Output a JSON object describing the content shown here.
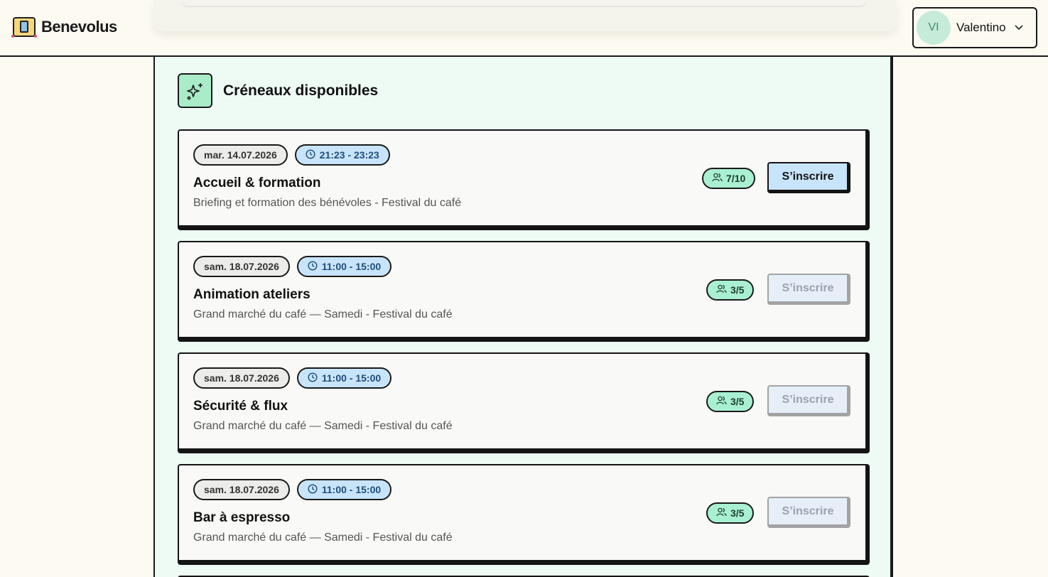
{
  "app": {
    "name": "Benevolus"
  },
  "user": {
    "initials": "VI",
    "name": "Valentino"
  },
  "section": {
    "title": "Créneaux disponibles"
  },
  "slots": [
    {
      "date": "mar. 14.07.2026",
      "time": "21:23 - 23:23",
      "title": "Accueil & formation",
      "description": "Briefing et formation des bénévoles - Festival du café",
      "count": "7/10",
      "button": "S’inscrire",
      "enabled": true
    },
    {
      "date": "sam. 18.07.2026",
      "time": "11:00 - 15:00",
      "title": "Animation ateliers",
      "description": "Grand marché du café — Samedi - Festival du café",
      "count": "3/5",
      "button": "S’inscrire",
      "enabled": false
    },
    {
      "date": "sam. 18.07.2026",
      "time": "11:00 - 15:00",
      "title": "Sécurité & flux",
      "description": "Grand marché du café — Samedi - Festival du café",
      "count": "3/5",
      "button": "S’inscrire",
      "enabled": false
    },
    {
      "date": "sam. 18.07.2026",
      "time": "11:00 - 15:00",
      "title": "Bar à espresso",
      "description": "Grand marché du café — Samedi - Festival du café",
      "count": "3/5",
      "button": "S’inscrire",
      "enabled": false
    }
  ],
  "icons": {
    "logo": "benevolus-logo",
    "section": "sparkles-icon",
    "time": "clock-icon",
    "count": "users-icon",
    "user_menu": "chevron-down-icon"
  },
  "colors": {
    "page_bg": "#fdfbf1",
    "panel_bg": "#eefbf5",
    "accent_blue": "#c8e4fb",
    "accent_green": "#a9f0d2"
  }
}
